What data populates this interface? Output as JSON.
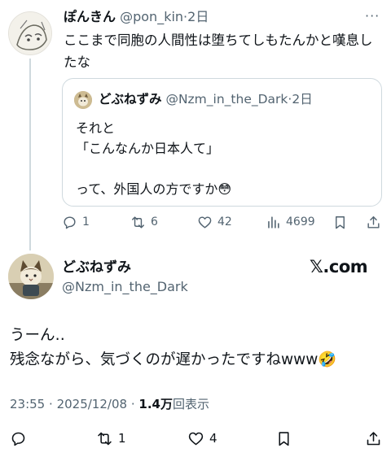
{
  "parent_tweet": {
    "display_name": "ぽんきん",
    "handle": "@pon_kin",
    "separator": "·",
    "time": "2日",
    "more": "···",
    "text": "ここまで同胞の人間性は堕ちてしもたんかと嘆息したな",
    "quote": {
      "display_name": "どぶねずみ",
      "handle": "@Nzm_in_the_Dark",
      "separator": "·",
      "time": "2日",
      "text": "それと\n「こんなんか日本人て」\n\nって、外国人の方ですか😳"
    },
    "actions": {
      "replies": "1",
      "retweets": "6",
      "likes": "42",
      "views": "4699"
    }
  },
  "main_tweet": {
    "display_name": "どぶねずみ",
    "handle": "@Nzm_in_the_Dark",
    "brand": "𝕏.com",
    "text": "うーん‥\n残念ながら、気づくのが遅かったですねwww🤣",
    "time": "23:55",
    "dot": "·",
    "date": "2025/12/08",
    "views_count": "1.4万",
    "views_label": "回表示",
    "actions": {
      "replies": "",
      "retweets": "1",
      "likes": "4"
    }
  }
}
